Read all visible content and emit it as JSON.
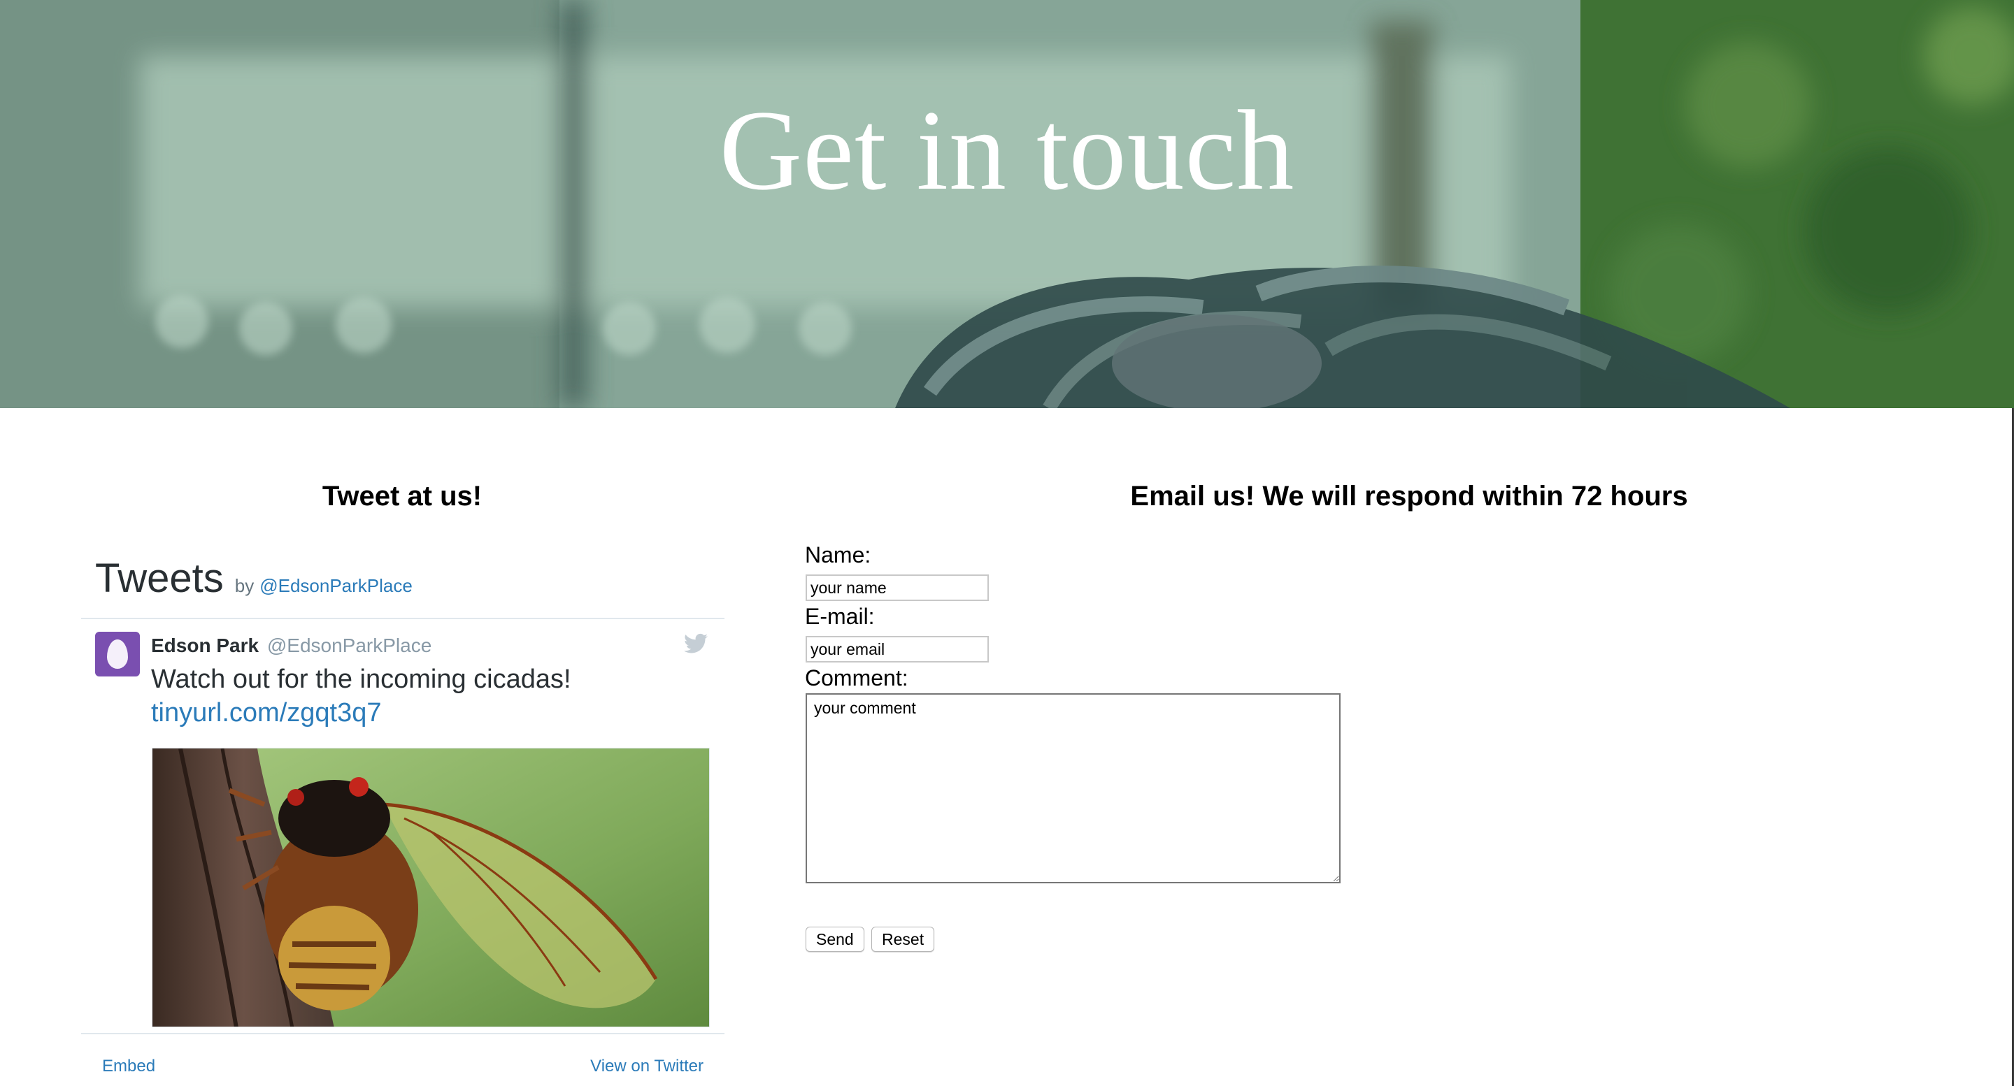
{
  "hero": {
    "title": "Get in touch"
  },
  "twitter_section": {
    "heading": "Tweet at us!",
    "widget": {
      "title": "Tweets",
      "by_label": "by",
      "handle": "@EdsonParkPlace",
      "tweet": {
        "author_name": "Edson Park",
        "author_handle": "@EdsonParkPlace",
        "text": "Watch out for the incoming cicadas!",
        "link": "tinyurl.com/zgqt3q7"
      },
      "footer": {
        "embed_label": "Embed",
        "view_label": "View on Twitter"
      }
    }
  },
  "email_section": {
    "heading": "Email us! We will respond within 72 hours",
    "name_label": "Name:",
    "name_placeholder": "your name",
    "email_label": "E-mail:",
    "email_placeholder": "your email",
    "comment_label": "Comment:",
    "comment_placeholder": "your comment",
    "send_label": "Send",
    "reset_label": "Reset"
  },
  "colors": {
    "link_blue": "#2b7bb9",
    "avatar_purple": "#7a4fb0",
    "hero_teal": "#8fae9f",
    "hero_green": "#3b6d32"
  },
  "icons": {
    "twitter_bird": "bird-icon",
    "avatar": "egg-avatar-icon"
  }
}
